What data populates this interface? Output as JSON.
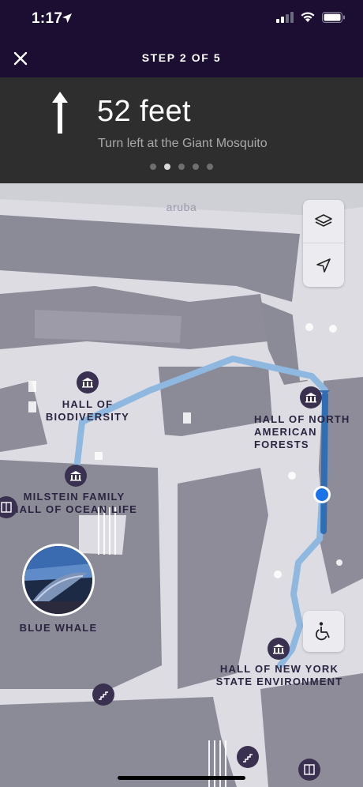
{
  "status_bar": {
    "time": "1:17"
  },
  "nav": {
    "title": "STEP 2 OF 5"
  },
  "direction": {
    "distance": "52 feet",
    "instruction": "Turn left at the Giant Mosquito",
    "step_count": 5,
    "active_step": 2
  },
  "map": {
    "logo": "aruba",
    "pois": {
      "biodiversity": "HALL OF\nBIODIVERSITY",
      "north_american": "HALL OF NORTH\nAMERICAN FORESTS",
      "milstein": "MILSTEIN FAMILY\nHALL OF OCEAN LIFE",
      "blue_whale": "BLUE WHALE",
      "new_york": "HALL OF NEW YORK\nSTATE ENVIRONMENT"
    },
    "icons": {
      "layers": "layers-icon",
      "locate": "location-arrow-icon",
      "accessibility": "wheelchair-icon"
    }
  },
  "colors": {
    "header_bg": "#1c0d33",
    "panel_bg": "#2e2e2e",
    "route_completed": "#2f6db4",
    "route_ahead": "#8fb8e0",
    "current_location": "#1a73e8"
  }
}
